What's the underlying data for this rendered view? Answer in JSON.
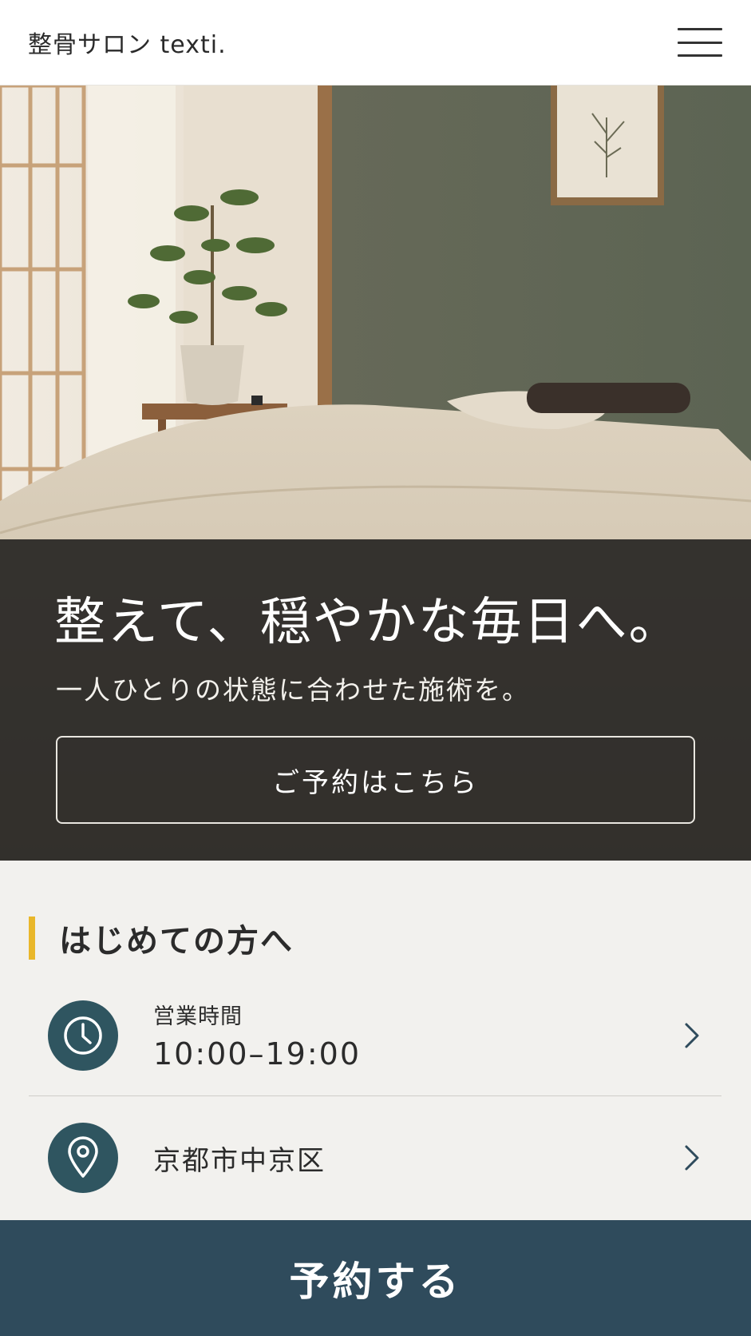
{
  "header": {
    "logo": "整骨サロン texti.",
    "menu_icon": "hamburger-menu-icon"
  },
  "hero": {
    "title": "整えて、穏やかな毎日へ。",
    "subtitle": "一人ひとりの状態に合わせた施術を。",
    "cta_label": "ご予約はこちら"
  },
  "intro": {
    "section_title": "はじめての方へ",
    "accent_color": "#e9b72a",
    "items": [
      {
        "icon": "clock-icon",
        "label": "営業時間",
        "value": "10:00–19:00"
      },
      {
        "icon": "location-pin-icon",
        "value": "京都市中京区"
      }
    ]
  },
  "bottom_cta": {
    "label": "予約する",
    "color": "#2f4b5c"
  }
}
